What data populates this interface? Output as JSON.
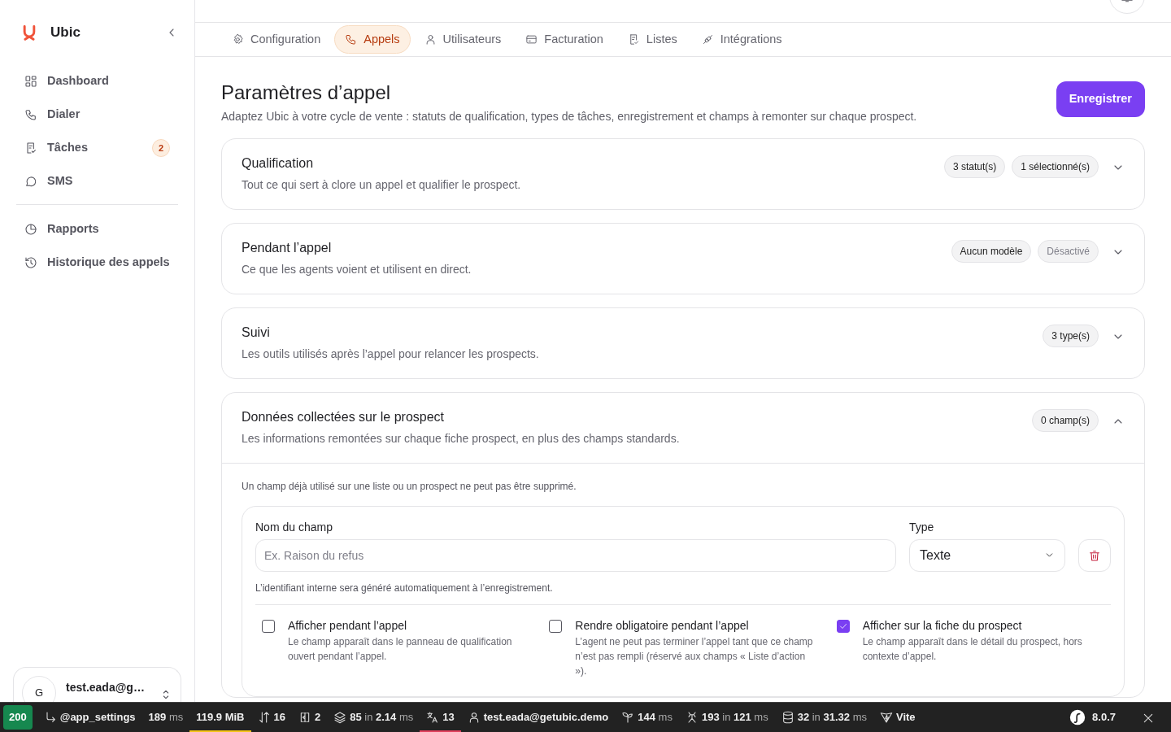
{
  "sidebar": {
    "brand": "Ubic",
    "nav_groups": [
      [
        {
          "label": "Dashboard"
        },
        {
          "label": "Dialer"
        },
        {
          "label": "Tâches",
          "badge": "2"
        },
        {
          "label": "SMS"
        }
      ],
      [
        {
          "label": "Rapports"
        },
        {
          "label": "Historique des appels"
        }
      ]
    ],
    "user": {
      "initial": "G",
      "email": "test.eada@g…"
    }
  },
  "tabs": [
    {
      "label": "Configuration",
      "selected": false
    },
    {
      "label": "Appels",
      "selected": true
    },
    {
      "label": "Utilisateurs",
      "selected": false
    },
    {
      "label": "Facturation",
      "selected": false
    },
    {
      "label": "Listes",
      "selected": false
    },
    {
      "label": "Intégrations",
      "selected": false
    }
  ],
  "page": {
    "title": "Paramètres d’appel",
    "subtitle": "Adaptez Ubic à votre cycle de vente : statuts de qualification, types de tâches, enregistrement et champs à remonter sur chaque prospect.",
    "save": "Enregistrer"
  },
  "sections": [
    {
      "title": "Qualification",
      "description": "Tout ce qui sert à clore un appel et qualifier le prospect.",
      "expanded": false,
      "badges": [
        {
          "text": "3 statut(s)",
          "muted": false
        },
        {
          "text": "1 sélectionné(s)",
          "muted": false
        }
      ]
    },
    {
      "title": "Pendant l’appel",
      "description": "Ce que les agents voient et utilisent en direct.",
      "expanded": false,
      "badges": [
        {
          "text": "Aucun modèle",
          "muted": false
        },
        {
          "text": "Désactivé",
          "muted": true
        }
      ]
    },
    {
      "title": "Suivi",
      "description": "Les outils utilisés après l’appel pour relancer les prospects.",
      "expanded": false,
      "badges": [
        {
          "text": "3 type(s)",
          "muted": false
        }
      ]
    },
    {
      "title": "Données collectées sur le prospect",
      "description": "Les informations remontées sur chaque fiche prospect, en plus des champs standards.",
      "expanded": true,
      "badges": [
        {
          "text": "0 champ(s)",
          "muted": false
        }
      ],
      "body": {
        "note": "Un champ déjà utilisé sur une liste ou un prospect ne peut pas être supprimé.",
        "field": {
          "name_label": "Nom du champ",
          "placeholder": "Ex. Raison du refus",
          "type_label": "Type",
          "type_value": "Texte",
          "hint": "L’identifiant interne sera généré automatiquement à l’enregistrement.",
          "options": [
            {
              "label": "Afficher pendant l’appel",
              "description": "Le champ apparaît dans le panneau de qualification ouvert pendant l’appel.",
              "checked": false
            },
            {
              "label": "Rendre obligatoire pendant l’appel",
              "description": "L’agent ne peut pas terminer l’appel tant que ce champ n’est pas rempli (réservé aux champs « Liste d’action »).",
              "checked": false
            },
            {
              "label": "Afficher sur la fiche du prospect",
              "description": "Le champ apparaît dans le détail du prospect, hors contexte d’appel.",
              "checked": true
            }
          ]
        }
      }
    }
  ],
  "toolbar": {
    "status": "200",
    "items": [
      {
        "parts": [
          {
            "t": "@app_settings"
          }
        ]
      },
      {
        "parts": [
          {
            "t": "189"
          },
          {
            "t": "ms",
            "muted": true
          }
        ]
      },
      {
        "parts": [
          {
            "t": "119.9 MiB"
          }
        ],
        "color": "#f5c518"
      },
      {
        "parts": [
          {
            "t": "16"
          }
        ]
      },
      {
        "parts": [
          {
            "t": "2"
          }
        ]
      },
      {
        "parts": [
          {
            "t": "85"
          },
          {
            "t": "in",
            "muted": true
          },
          {
            "t": "2.14"
          },
          {
            "t": "ms",
            "muted": true
          }
        ]
      },
      {
        "parts": [
          {
            "t": "13"
          }
        ],
        "color": "#e0415d"
      },
      {
        "parts": [
          {
            "t": "test.eada@getubic.demo"
          }
        ]
      },
      {
        "parts": [
          {
            "t": "144"
          },
          {
            "t": "ms",
            "muted": true
          }
        ]
      },
      {
        "parts": [
          {
            "t": "193"
          },
          {
            "t": "in",
            "muted": true
          },
          {
            "t": "121"
          },
          {
            "t": "ms",
            "muted": true
          }
        ]
      },
      {
        "parts": [
          {
            "t": "32"
          },
          {
            "t": "in",
            "muted": true
          },
          {
            "t": "31.32"
          },
          {
            "t": "ms",
            "muted": true
          }
        ]
      },
      {
        "parts": [
          {
            "t": "Vite"
          }
        ]
      }
    ],
    "version": "8.0.7"
  }
}
